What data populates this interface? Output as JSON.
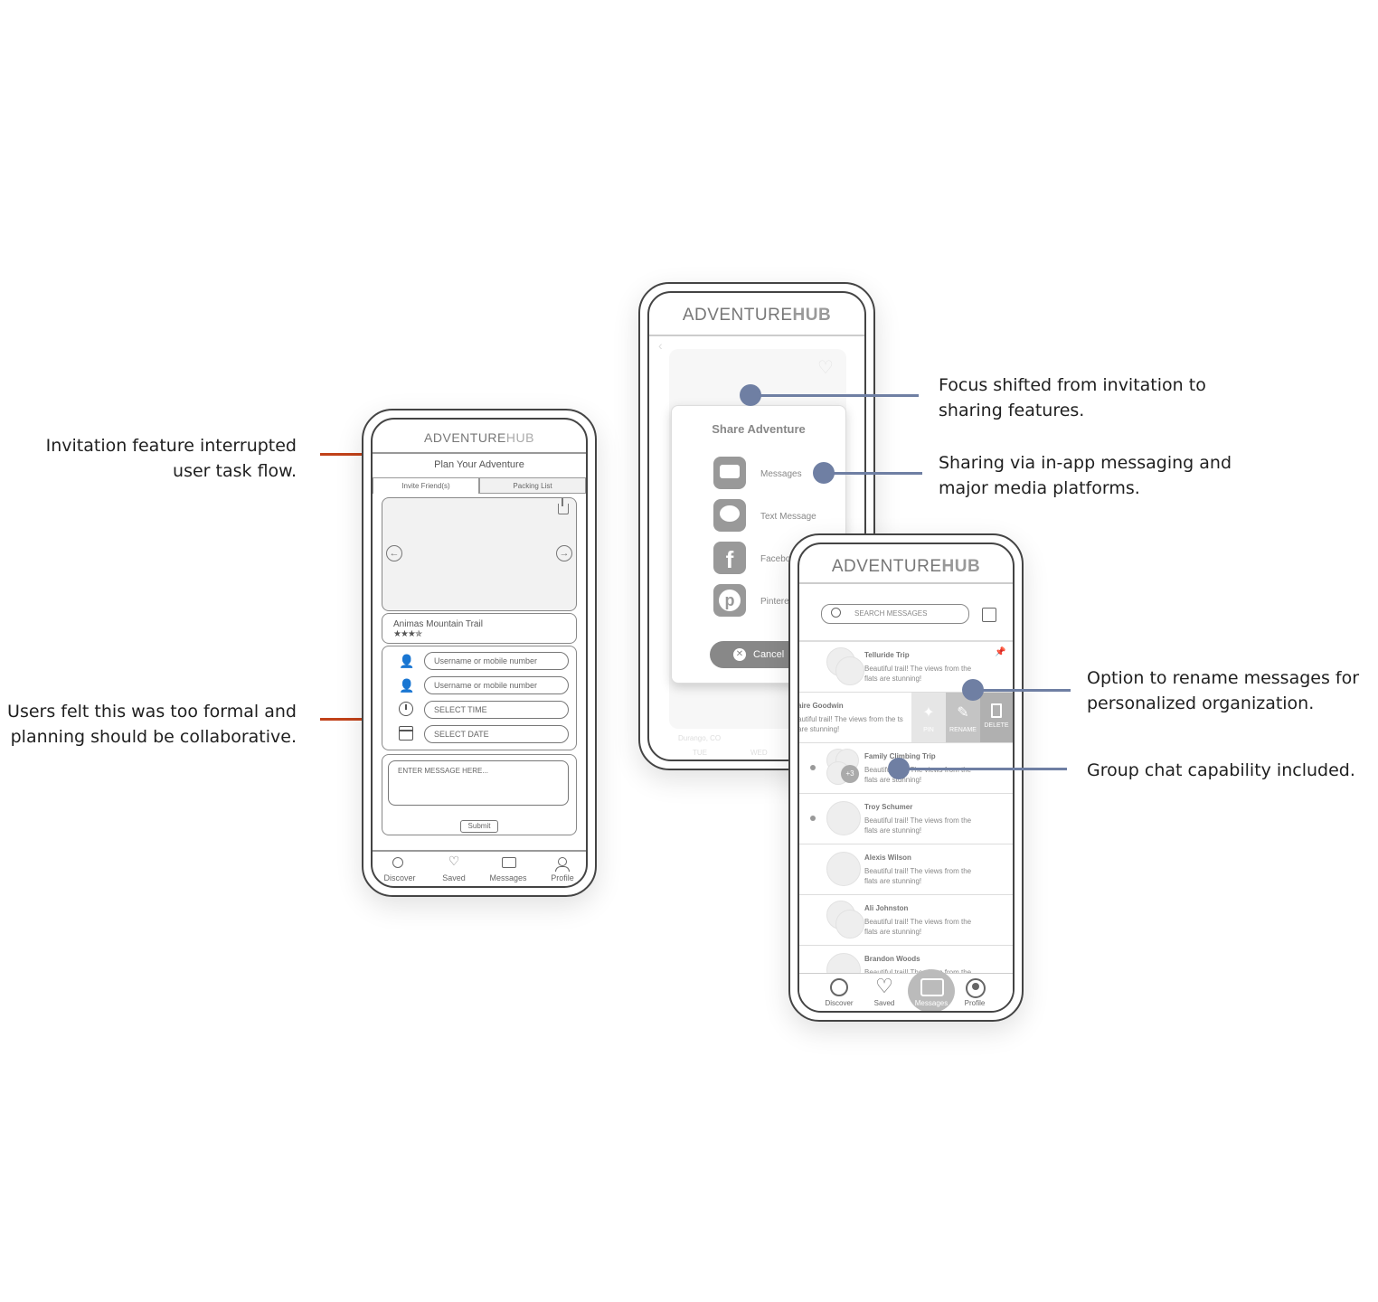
{
  "annotations": {
    "invite_interrupted": [
      "Invitation feature interrupted",
      "user task flow."
    ],
    "too_formal": [
      "Users felt this was too formal and",
      "planning should be collaborative."
    ],
    "focus_shift": [
      "Focus shifted from invitation to",
      "sharing features."
    ],
    "sharing_via": [
      "Sharing via in-app messaging and",
      "major media platforms."
    ],
    "rename": [
      "Option to rename messages for",
      "personalized organization."
    ],
    "group_chat": [
      "Group chat capability included."
    ]
  },
  "colors": {
    "orange": "#c1421a",
    "blue": "#6f7fa3"
  },
  "phone1": {
    "logo_a": "ADVENTURE",
    "logo_b": "HUB",
    "page_title": "Plan Your Adventure",
    "tabs": [
      "Invite Friend(s)",
      "Packing List"
    ],
    "trail_name": "Animas Mountain Trail",
    "rating": "★★★✯",
    "fields": {
      "username1": "Username or mobile number",
      "username2": "Username or mobile number",
      "time": "SELECT TIME",
      "date": "SELECT DATE"
    },
    "message_placeholder": "ENTER MESSAGE HERE...",
    "submit_label": "Submit",
    "nav": [
      "Discover",
      "Saved",
      "Messages",
      "Profile"
    ]
  },
  "phone2": {
    "logo_a": "ADVENTURE",
    "logo_b": "HUB",
    "modal_title": "Share Adventure",
    "options": [
      "Messages",
      "Text Message",
      "Facebo",
      "Pintere"
    ],
    "cancel_label": "Cancel",
    "bg_text": [
      "Durango, CO",
      "TUE",
      "WED"
    ]
  },
  "phone3": {
    "logo_a": "ADVENTURE",
    "logo_b": "HUB",
    "search_placeholder": "SEARCH MESSAGES",
    "swipe_actions": [
      "PIN",
      "RENAME",
      "DELETE"
    ],
    "group_badge": "+3",
    "messages": [
      {
        "name": "Telluride Trip",
        "text": "Beautiful trail! The views from the flats are stunning!"
      },
      {
        "name": "aire Goodwin",
        "text": "autiful trail! The views from the ts are stunning!"
      },
      {
        "name": "Family Climbing Trip",
        "text": "Beautiful trail! The views from the flats are stunning!"
      },
      {
        "name": "Troy Schumer",
        "text": "Beautiful trail! The views from the flats are stunning!"
      },
      {
        "name": "Alexis Wilson",
        "text": "Beautiful trail! The views from the flats are stunning!"
      },
      {
        "name": "Ali Johnston",
        "text": "Beautiful trail! The views from the flats are stunning!"
      },
      {
        "name": "Brandon Woods",
        "text": "Beautiful trail! The views from the"
      }
    ],
    "nav": [
      "Discover",
      "Saved",
      "Messages",
      "Profile"
    ]
  }
}
